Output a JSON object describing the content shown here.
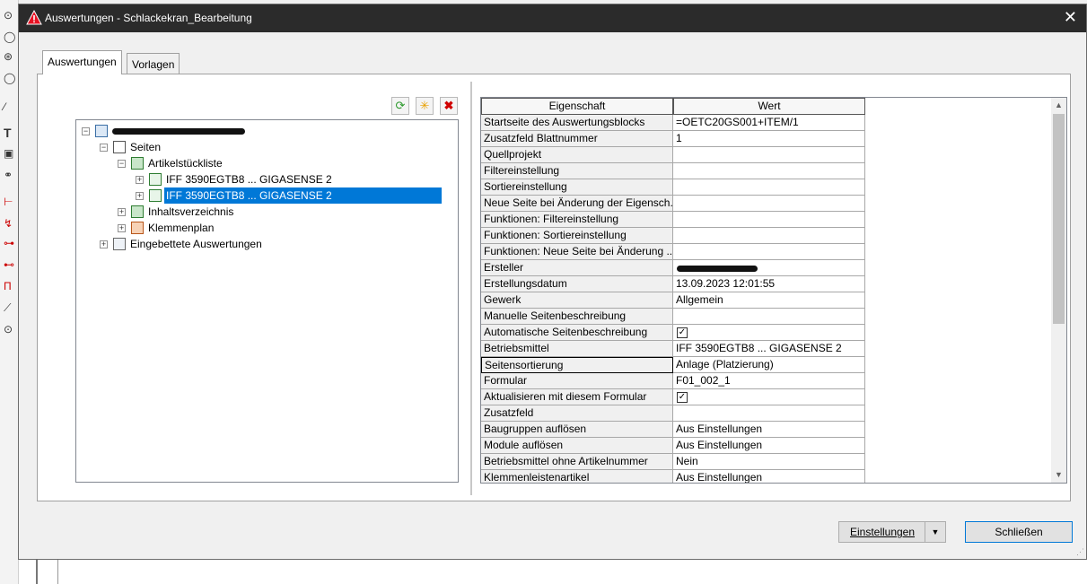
{
  "window": {
    "title": "Auswertungen - Schlackekran_Bearbeitung",
    "close_symbol": "✕",
    "warning_icon": "warning-triangle-icon"
  },
  "tabs": [
    {
      "label": "Auswertungen",
      "active": true
    },
    {
      "label": "Vorlagen",
      "active": false
    }
  ],
  "tree_toolbar": {
    "refresh_icon": "refresh-icon",
    "new_icon": "new-star-icon",
    "delete_icon": "delete-icon"
  },
  "tree": {
    "root": {
      "label": "Schlackekran_Bearbeitung",
      "redacted": true
    },
    "seiten": "Seiten",
    "artikelstueckliste": "Artikelstückliste",
    "iff1": "IFF 3590EGTB8 ... GIGASENSE 2",
    "iff2": "IFF 3590EGTB8 ... GIGASENSE 2",
    "inhaltsverzeichnis": "Inhaltsverzeichnis",
    "klemmenplan": "Klemmenplan",
    "eingebettete": "Eingebettete Auswertungen"
  },
  "grid": {
    "header_property": "Eigenschaft",
    "header_value": "Wert",
    "rows": [
      {
        "name": "Startseite des Auswertungsblocks",
        "value": "=OETC20GS001+ITEM/1"
      },
      {
        "name": "Zusatzfeld Blattnummer",
        "value": "1"
      },
      {
        "name": "Quellprojekt",
        "value": ""
      },
      {
        "name": "Filtereinstellung",
        "value": ""
      },
      {
        "name": "Sortiereinstellung",
        "value": ""
      },
      {
        "name": "Neue Seite bei Änderung der Eigensch...",
        "value": ""
      },
      {
        "name": "Funktionen: Filtereinstellung",
        "value": ""
      },
      {
        "name": "Funktionen: Sortiereinstellung",
        "value": ""
      },
      {
        "name": "Funktionen: Neue Seite bei Änderung ...",
        "value": ""
      },
      {
        "name": "Ersteller",
        "value": "",
        "redacted": true
      },
      {
        "name": "Erstellungsdatum",
        "value": "13.09.2023 12:01:55"
      },
      {
        "name": "Gewerk",
        "value": "Allgemein"
      },
      {
        "name": "Manuelle Seitenbeschreibung",
        "value": ""
      },
      {
        "name": "Automatische Seitenbeschreibung",
        "value": "",
        "checkbox": true,
        "checked": true
      },
      {
        "name": "Betriebsmittel",
        "value": "IFF 3590EGTB8 ... GIGASENSE 2"
      },
      {
        "name": "Seitensortierung",
        "value": "Anlage (Platzierung)",
        "focused": true
      },
      {
        "name": "Formular",
        "value": "F01_002_1"
      },
      {
        "name": "Aktualisieren mit diesem Formular",
        "value": "",
        "checkbox": true,
        "checked": true
      },
      {
        "name": "Zusatzfeld",
        "value": ""
      },
      {
        "name": "Baugruppen auflösen",
        "value": "Aus Einstellungen"
      },
      {
        "name": "Module auflösen",
        "value": "Aus Einstellungen"
      },
      {
        "name": "Betriebsmittel ohne Artikelnummer",
        "value": "Nein"
      },
      {
        "name": "Klemmenleistenartikel",
        "value": "Aus Einstellungen"
      }
    ]
  },
  "buttons": {
    "settings_label": "Einstellungen",
    "close_label": "Schließen"
  },
  "colors": {
    "titlebar": "#2b2b2b",
    "selection": "#0078d7",
    "panel": "#f0f0f0"
  }
}
